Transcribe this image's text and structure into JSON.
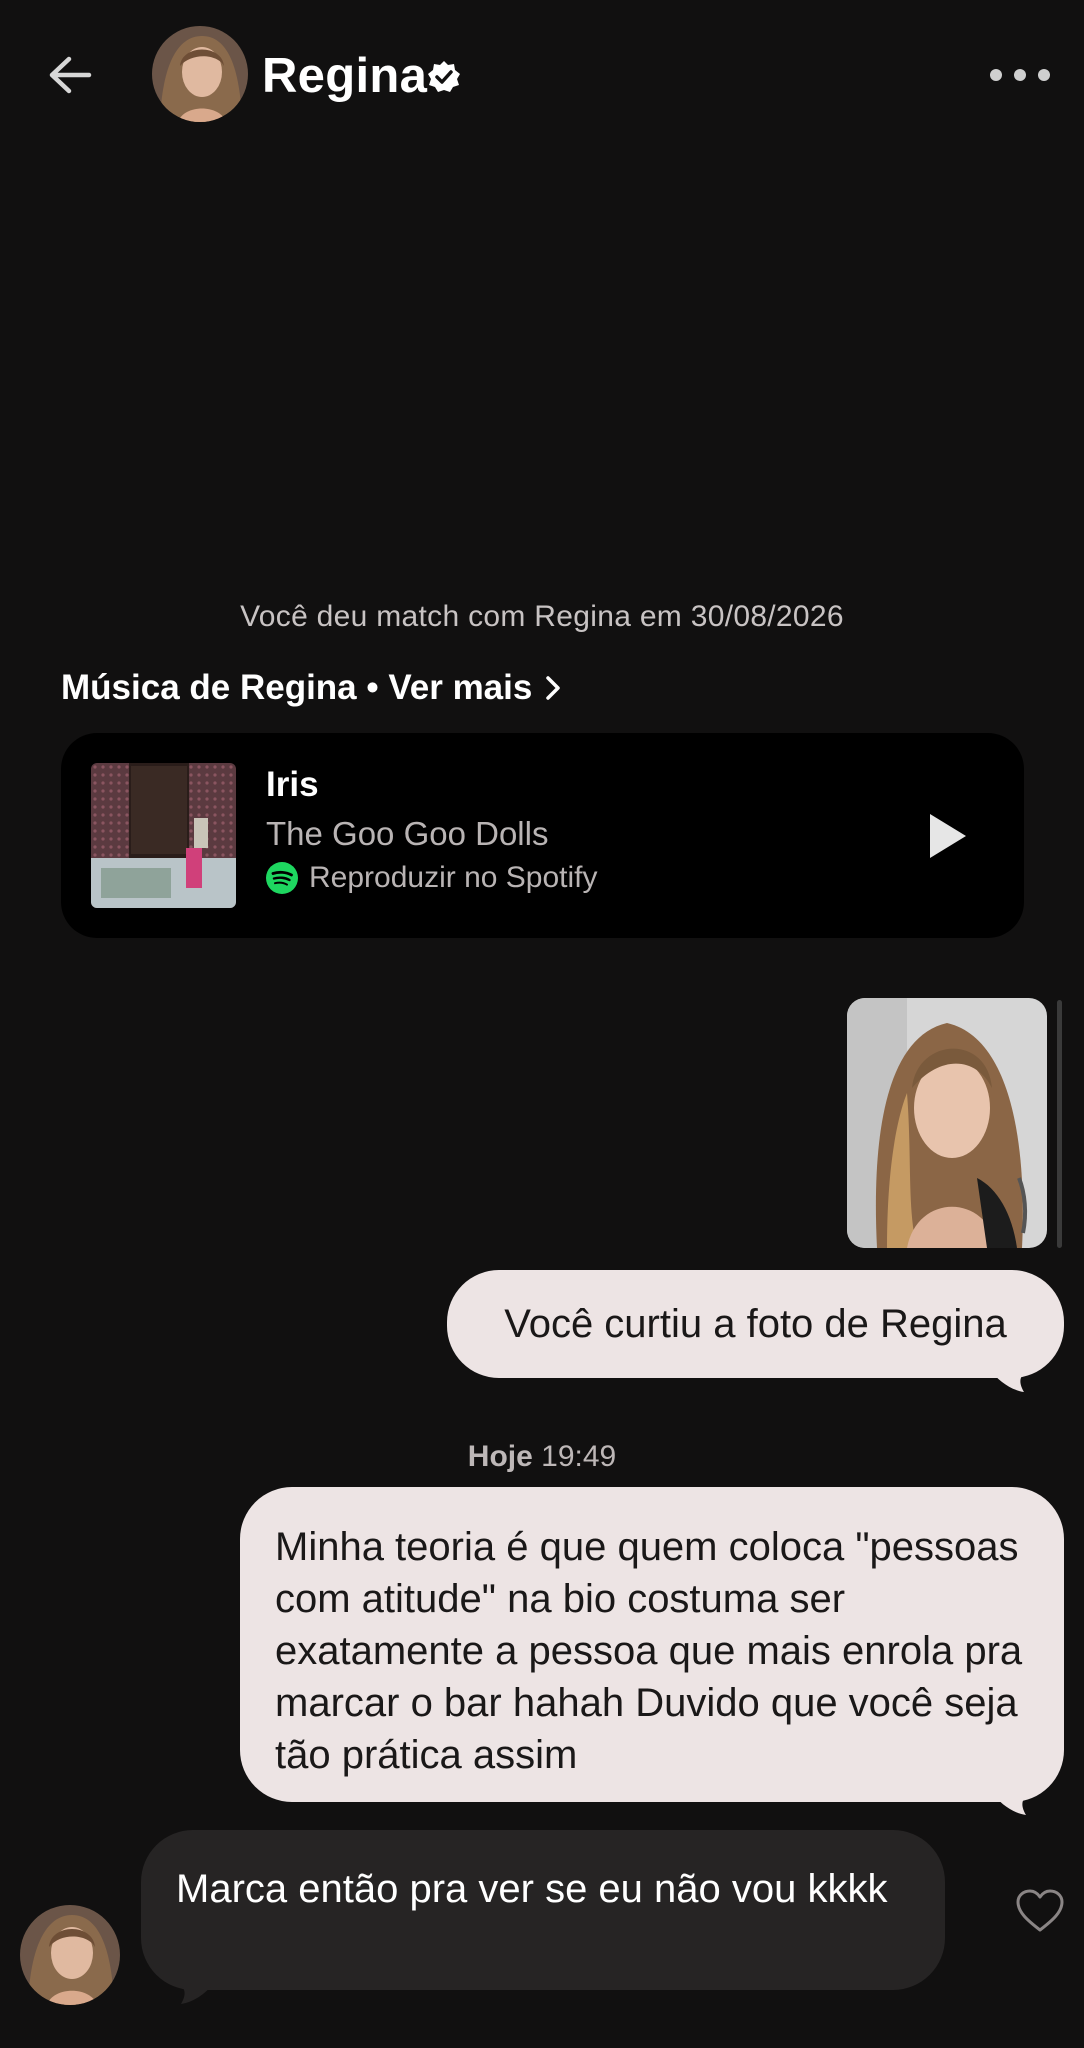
{
  "header": {
    "name": "Regina",
    "back_icon": "arrow-left-icon",
    "verified_icon": "verified-badge-icon",
    "more_icon": "more-horizontal-icon"
  },
  "match_info": "Você deu match com Regina em 30/08/2026",
  "music": {
    "section_title": "Música de Regina • Ver mais",
    "song_title": "Iris",
    "artist": "The Goo Goo Dolls",
    "spotify_label": "Reproduzir no Spotify",
    "spotify_color": "#1ed760"
  },
  "messages": {
    "liked_photo": "Você curtiu a foto de Regina",
    "time_day": "Hoje",
    "time_clock": "19:49",
    "outgoing_text": "Minha teoria é que quem coloca \"pessoas com atitude\" na bio costuma ser exatamente a pessoa que mais enrola pra marcar o bar hahah Duvido que você seja tão prática assim",
    "incoming_text": "Marca então pra ver se eu não vou kkkk"
  },
  "colors": {
    "background": "#111010",
    "outgoing_bubble": "#ede4e4",
    "incoming_bubble": "#262424",
    "card": "#000000"
  }
}
